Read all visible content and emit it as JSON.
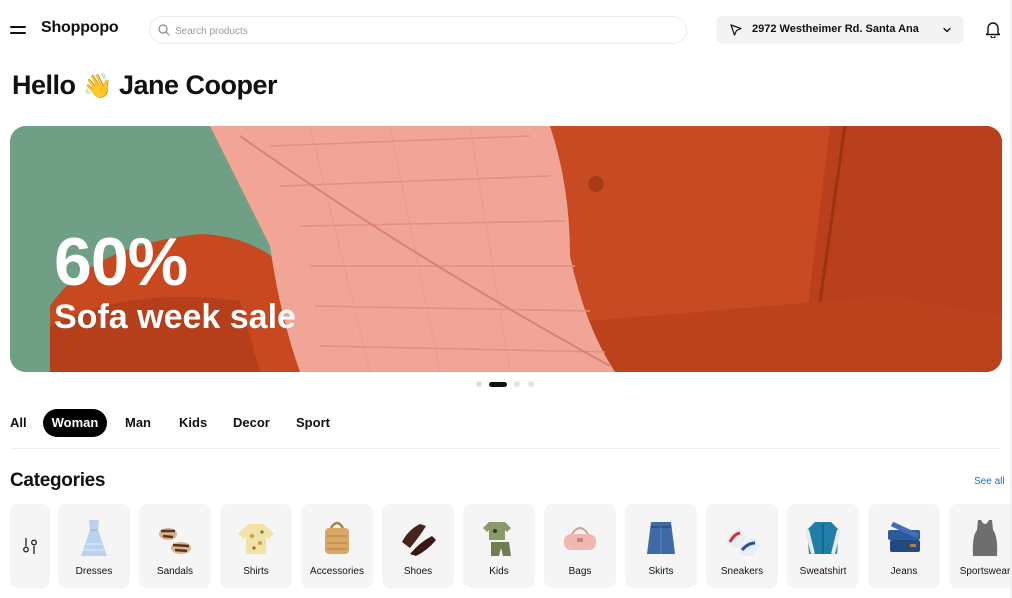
{
  "header": {
    "logo": "Shoppopo",
    "search_placeholder": "Search products",
    "location": "2972 Westheimer Rd. Santa Ana"
  },
  "greeting": {
    "hello": "Hello",
    "emoji": "👋",
    "name": "Jane Cooper"
  },
  "hero": {
    "percent": "60%",
    "subtitle": "Sofa week sale",
    "slide_count": 4,
    "active_slide": 2,
    "colors": {
      "background": "#6f9f84",
      "sofa": "#c84a22",
      "cushion": "#f1a597"
    }
  },
  "tabs": [
    {
      "label": "All",
      "active": false
    },
    {
      "label": "Woman",
      "active": true
    },
    {
      "label": "Man",
      "active": false
    },
    {
      "label": "Kids",
      "active": false
    },
    {
      "label": "Decor",
      "active": false
    },
    {
      "label": "Sport",
      "active": false
    }
  ],
  "categories": {
    "title": "Categories",
    "see_all": "See all",
    "filter_icon": "filter-sliders-icon",
    "items": [
      {
        "label": "Dresses",
        "icon": "dress-icon"
      },
      {
        "label": "Sandals",
        "icon": "sandals-icon"
      },
      {
        "label": "Shirts",
        "icon": "shirt-icon"
      },
      {
        "label": "Accessories",
        "icon": "accessories-icon"
      },
      {
        "label": "Shoes",
        "icon": "shoes-icon"
      },
      {
        "label": "Kids",
        "icon": "kids-outfit-icon"
      },
      {
        "label": "Bags",
        "icon": "bag-icon"
      },
      {
        "label": "Skirts",
        "icon": "skirt-icon"
      },
      {
        "label": "Sneakers",
        "icon": "sneakers-icon"
      },
      {
        "label": "Sweatshirt",
        "icon": "jacket-icon"
      },
      {
        "label": "Jeans",
        "icon": "jeans-icon"
      },
      {
        "label": "Sportswear",
        "icon": "tank-top-icon"
      }
    ]
  }
}
